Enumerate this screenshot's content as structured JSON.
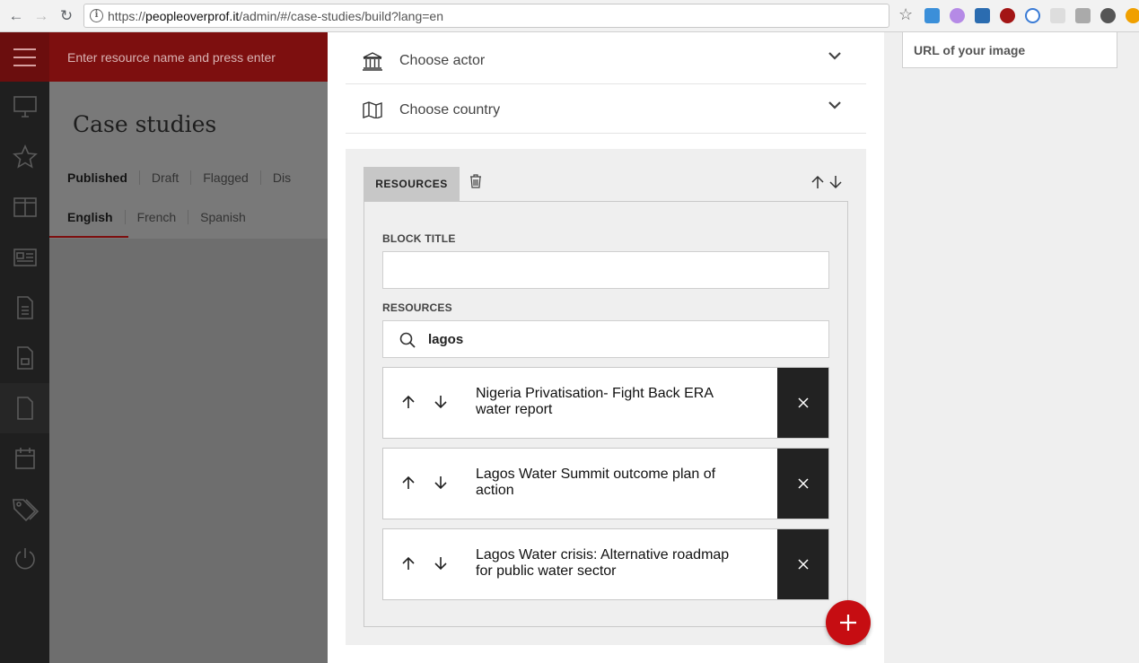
{
  "browser": {
    "url_prefix": "https://",
    "url_host": "peopleoverprof.it",
    "url_path": "/admin/#/case-studies/build?lang=en"
  },
  "topbar": {
    "search_placeholder": "Enter resource name and press enter"
  },
  "page": {
    "title": "Case studies",
    "status_tabs": [
      "Published",
      "Draft",
      "Flagged",
      "Dis"
    ],
    "lang_tabs": [
      "English",
      "French",
      "Spanish"
    ]
  },
  "modal": {
    "actor_select": "Choose actor",
    "country_select": "Choose country",
    "block": {
      "tab_label": "RESOURCES",
      "block_title_label": "BLOCK TITLE",
      "block_title_value": "",
      "resources_label": "RESOURCES",
      "search_value": "lagos",
      "items": [
        {
          "title": "Nigeria Privatisation- Fight Back ERA water report"
        },
        {
          "title": "Lagos Water Summit outcome plan of action"
        },
        {
          "title": "Lagos Water crisis: Alternative roadmap for public water sector"
        }
      ]
    }
  },
  "right_panel": {
    "image_url_placeholder": "URL of your image"
  },
  "colors": {
    "brand_red": "#c60d12",
    "dark_red": "#7d0f0f"
  }
}
